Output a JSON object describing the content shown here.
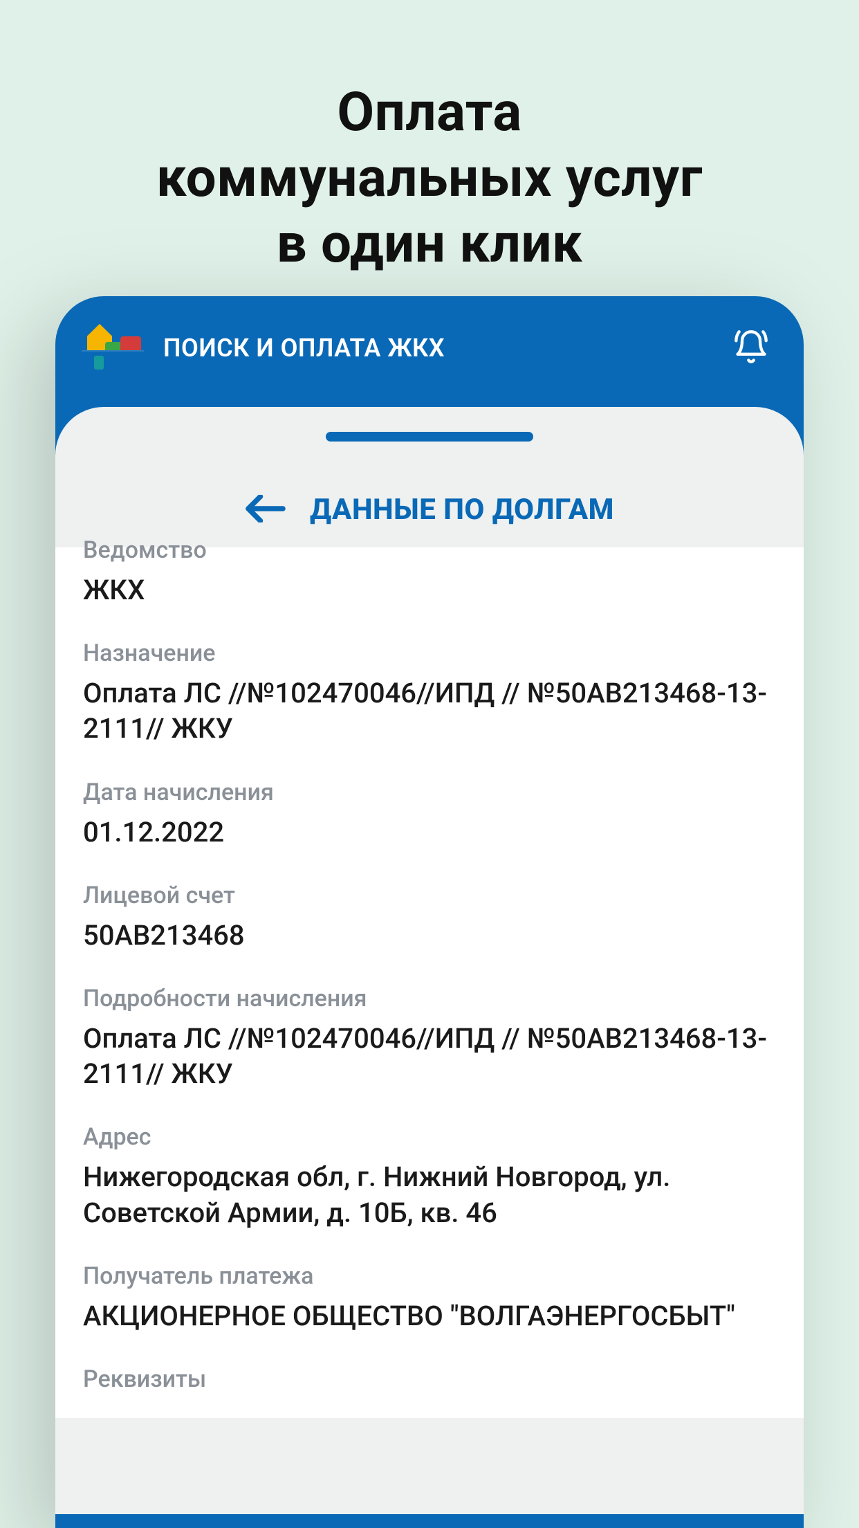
{
  "hero": {
    "line1": "Оплата",
    "line2": "коммунальных услуг",
    "line3": "в один клик"
  },
  "appbar": {
    "title": "ПОИСК И ОПЛАТА ЖКХ"
  },
  "sheet": {
    "title": "ДАННЫЕ ПО ДОЛГАМ"
  },
  "fields": {
    "department_label": "Ведомство",
    "department_value": "ЖКХ",
    "purpose_label": "Назначение",
    "purpose_value": "Оплата ЛС  //№102470046//ИПД // №50АВ213468-13-2111// ЖКУ",
    "date_label": "Дата начисления",
    "date_value": "01.12.2022",
    "account_label": "Лицевой счет",
    "account_value": "50АВ213468",
    "details_label": "Подробности начисления",
    "details_value": "Оплата ЛС  //№102470046//ИПД // №50АВ213468-13-2111// ЖКУ",
    "address_label": "Адрес",
    "address_value": "Нижегородская обл, г. Нижний Новгород, ул. Советской Армии, д. 10Б, кв. 46",
    "payee_label": "Получатель платежа",
    "payee_value": "АКЦИОНЕРНОЕ ОБЩЕСТВО \"ВОЛГАЭНЕРГОСБЫТ\"",
    "requisites_label": "Реквизиты"
  }
}
